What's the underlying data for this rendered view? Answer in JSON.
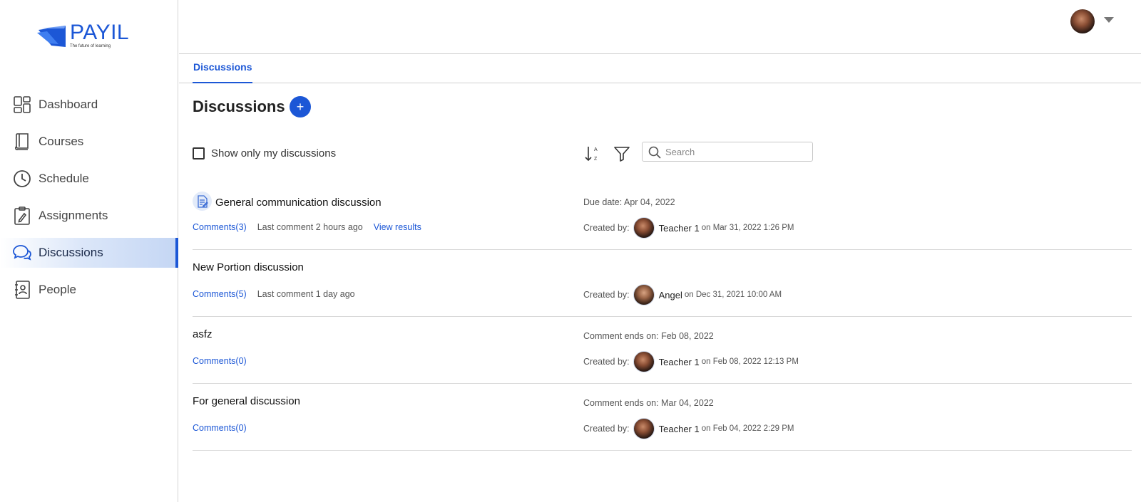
{
  "brand": {
    "name": "PAYIL",
    "tagline": "The future of learning",
    "color": "#1c57d6"
  },
  "sidebar": {
    "items": [
      {
        "label": "Dashboard",
        "icon": "dashboard-icon",
        "active": false
      },
      {
        "label": "Courses",
        "icon": "book-icon",
        "active": false
      },
      {
        "label": "Schedule",
        "icon": "clock-icon",
        "active": false
      },
      {
        "label": "Assignments",
        "icon": "clipboard-icon",
        "active": false
      },
      {
        "label": "Discussions",
        "icon": "chat-bubbles-icon",
        "active": true
      },
      {
        "label": "People",
        "icon": "contact-book-icon",
        "active": false
      }
    ]
  },
  "header": {
    "avatar_icon": "user-avatar",
    "menu_icon": "caret-down-icon"
  },
  "tabs": [
    {
      "label": "Discussions",
      "active": true
    }
  ],
  "main": {
    "title": "Discussions",
    "add_label": "+",
    "filter": {
      "checkbox_label": "Show only my discussions",
      "checked": false,
      "search_placeholder": "Search",
      "search_value": ""
    },
    "discussions": [
      {
        "title": "General communication discussion",
        "has_doc_icon": true,
        "comments": "Comments(3)",
        "last_comment": "Last comment 2 hours ago",
        "extra_link": "View results",
        "right_top": "Due date: Apr 04, 2022",
        "created_by_label": "Created by:",
        "creator": "Teacher 1",
        "created_on": "on Mar 31, 2022 1:26 PM"
      },
      {
        "title": "New Portion discussion",
        "has_doc_icon": false,
        "comments": "Comments(5)",
        "last_comment": "Last comment 1 day ago",
        "extra_link": "",
        "right_top": "",
        "created_by_label": "Created by:",
        "creator": "Angel",
        "created_on": "on Dec 31, 2021 10:00 AM"
      },
      {
        "title": "asfz",
        "has_doc_icon": false,
        "comments": "Comments(0)",
        "last_comment": "",
        "extra_link": "",
        "right_top": "Comment ends on: Feb 08, 2022",
        "created_by_label": "Created by:",
        "creator": "Teacher 1",
        "created_on": "on Feb 08, 2022 12:13 PM"
      },
      {
        "title": "For general discussion",
        "has_doc_icon": false,
        "comments": "Comments(0)",
        "last_comment": "",
        "extra_link": "",
        "right_top": "Comment ends on: Mar 04, 2022",
        "created_by_label": "Created by:",
        "creator": "Teacher 1",
        "created_on": "on Feb 04, 2022 2:29 PM"
      }
    ]
  }
}
